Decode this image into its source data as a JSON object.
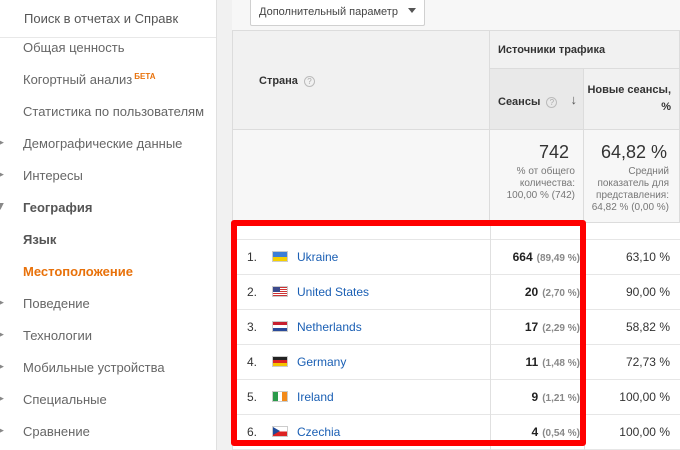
{
  "sidebar": {
    "search_placeholder": "Поиск в отчетах и Справк",
    "items": [
      {
        "label": "Общая ценность"
      },
      {
        "label": "Когортный анализ",
        "badge": "БЕТА"
      },
      {
        "label": "Статистика по пользователям"
      },
      {
        "label": "Демографические данные"
      },
      {
        "label": "Интересы"
      },
      {
        "label": "География"
      },
      {
        "label": "Язык"
      },
      {
        "label": "Местоположение"
      },
      {
        "label": "Поведение"
      },
      {
        "label": "Технологии"
      },
      {
        "label": "Мобильные устройства"
      },
      {
        "label": "Специальные"
      },
      {
        "label": "Сравнение"
      }
    ]
  },
  "toolbar": {
    "secondary_dimension_label": "Дополнительный параметр"
  },
  "table": {
    "country_header": "Страна",
    "group_header": "Источники трафика",
    "sessions_header": "Сеансы",
    "new_sessions_header": "Новые сеансы, %",
    "totals": {
      "sessions_value": "742",
      "sessions_note": "% от общего количества: 100,00 % (742)",
      "new_sessions_value": "64,82 %",
      "new_sessions_note": "Средний показатель для представления: 64,82 % (0,00 %)"
    },
    "rows": [
      {
        "n": "1.",
        "country": "Ukraine",
        "sessions": "664",
        "pct": "(89,49 %)",
        "new_pct": "63,10 %"
      },
      {
        "n": "2.",
        "country": "United States",
        "sessions": "20",
        "pct": "(2,70 %)",
        "new_pct": "90,00 %"
      },
      {
        "n": "3.",
        "country": "Netherlands",
        "sessions": "17",
        "pct": "(2,29 %)",
        "new_pct": "58,82 %"
      },
      {
        "n": "4.",
        "country": "Germany",
        "sessions": "11",
        "pct": "(1,48 %)",
        "new_pct": "72,73 %"
      },
      {
        "n": "5.",
        "country": "Ireland",
        "sessions": "9",
        "pct": "(1,21 %)",
        "new_pct": "100,00 %"
      },
      {
        "n": "6.",
        "country": "Czechia",
        "sessions": "4",
        "pct": "(0,54 %)",
        "new_pct": "100,00 %"
      }
    ]
  },
  "colors": {
    "accent": "#e8710a",
    "link": "#1a5fb4",
    "highlight": "#ff0000"
  }
}
